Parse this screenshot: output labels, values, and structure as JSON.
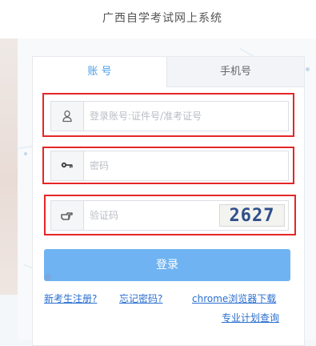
{
  "header": {
    "title": "广西自学考试网上系统"
  },
  "tabs": {
    "account_label": "账 号",
    "phone_label": "手机号"
  },
  "form": {
    "username_placeholder": "登录账号:证件号/准考证号",
    "password_placeholder": "密码",
    "captcha_placeholder": "验证码",
    "captcha_text": "2627"
  },
  "login_button": "登录",
  "links": {
    "register": "新考生注册?",
    "forgot": "忘记密码?",
    "chrome": "chrome浏览器下载",
    "plan": "专业计划查询"
  },
  "colors": {
    "accent": "#4a9ee8",
    "button": "#6fb3f2",
    "highlight": "#e52626",
    "link": "#2a6fd0"
  },
  "icons": {
    "username": "user-icon",
    "password": "key-icon",
    "captcha": "hand-pointer-icon"
  }
}
